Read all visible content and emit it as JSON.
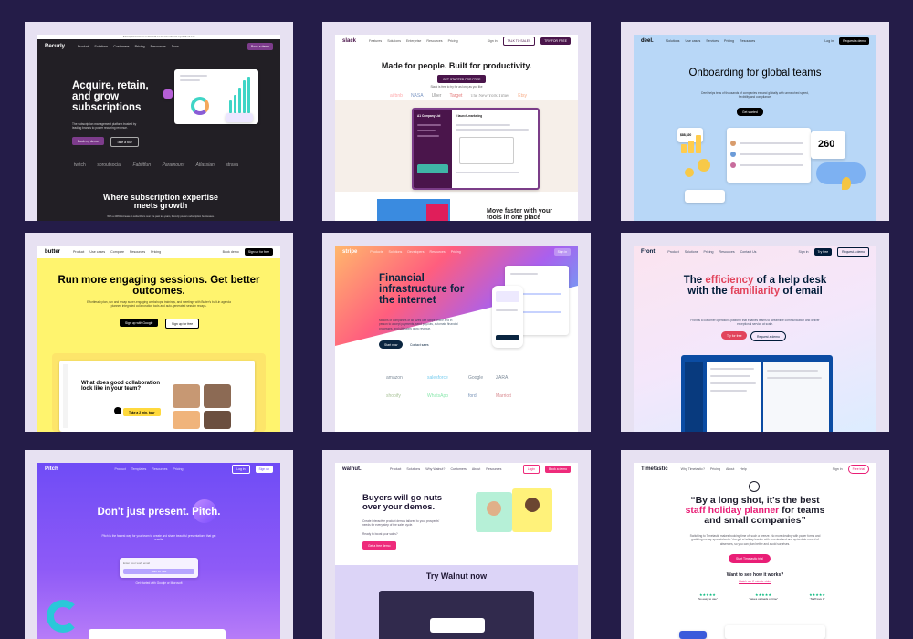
{
  "tiles": {
    "recurly": {
      "announcement": "Subscription business metrics with our latest benchmark report. Read now",
      "logo": "Recurly",
      "nav": [
        "Product",
        "Solutions",
        "Customers",
        "Pricing",
        "Resources",
        "Docs"
      ],
      "nav_btn": "Book a demo",
      "headline": "Acquire, retain, and grow subscriptions",
      "subtext": "The subscription management platform trusted by leading brands to power recurring revenue.",
      "cta_primary": "Book my demo",
      "cta_secondary": "Take a tour",
      "logos": [
        "twitch",
        "sproutsocial",
        "Fabfitfun",
        "Paramount",
        "Atlassian",
        "strava"
      ],
      "footer_headline": "Where subscription expertise meets growth",
      "footer_sub": "With a 400% increase in subscribers over the past ten years, Recurly powers subscription businesses."
    },
    "slack": {
      "logo": "slack",
      "nav": [
        "Features",
        "Solutions",
        "Enterprise",
        "Resources",
        "Pricing"
      ],
      "signin": "Sign in",
      "talk_btn": "TALK TO SALES",
      "try_btn": "TRY FOR FREE",
      "headline": "Made for people. Built for productivity.",
      "cta": "GET STARTED FOR FREE",
      "subtext": "Slack is free to try for as long as you like",
      "logos": [
        "airbnb",
        "NASA",
        "Uber",
        "Target",
        "The New York Times",
        "Etsy"
      ],
      "sidebar_title": "A1 Company Ltd",
      "channel": "# launch-marketing",
      "bottom_text": "Move faster with your tools in one place"
    },
    "deel": {
      "logo": "deel.",
      "nav": [
        "Solutions",
        "Use cases",
        "Services",
        "Pricing",
        "Resources"
      ],
      "login": "Log in",
      "demo_btn": "Request a demo",
      "headline": "Onboarding for global teams",
      "subtext": "Deel helps tens of thousands of companies expand globally with unmatched speed, flexibility and compliance.",
      "cta": "Get started",
      "stat_value": "260",
      "amount": "$88,520"
    },
    "butter": {
      "logo": "butter",
      "nav": [
        "Product",
        "Use cases",
        "Compare",
        "Resources",
        "Pricing"
      ],
      "signin": "Book demo",
      "signup": "Sign up for free",
      "headline": "Run more engaging sessions. Get better outcomes.",
      "subtext": "Effortlessly plan, run and recap super-engaging workshops, trainings, and meetings with Butter's built-in agenda planner, integrated collaboration tools and auto-generated session recaps.",
      "cta_primary": "Sign up with Google",
      "cta_secondary": "Sign up for free",
      "card_title": "What does good collaboration look like in your team?",
      "tour_label": "Take a 2 min. tour"
    },
    "stripe": {
      "logo": "stripe",
      "nav": [
        "Products",
        "Solutions",
        "Developers",
        "Resources",
        "Pricing"
      ],
      "signin": "Sign in",
      "headline": "Financial infrastructure for the internet",
      "subtext": "Millions of companies of all sizes use Stripe online and in person to accept payments, send payouts, automate financial processes, and ultimately grow revenue.",
      "cta_primary": "Start now",
      "cta_secondary": "Contact sales",
      "logos": [
        "amazon",
        "salesforce",
        "Google",
        "ZARA",
        "shopify",
        "WhatsApp",
        "ford",
        "Marriott"
      ]
    },
    "front": {
      "logo": "Front",
      "nav": [
        "Product",
        "Solutions",
        "Pricing",
        "Resources",
        "Contact Us"
      ],
      "signin": "Sign in",
      "demo_btn": "Request a demo",
      "free_btn": "Try free",
      "headline_1": "The ",
      "headline_2": "efficiency",
      "headline_3": " of a help desk with the ",
      "headline_4": "familiarity",
      "headline_5": " of email",
      "subtext": "Front is a customer operations platform that enables teams to streamline communication and deliver exceptional service at scale.",
      "cta_primary": "Try for free",
      "cta_secondary": "Request a demo"
    },
    "pitch": {
      "logo": "Pitch",
      "nav": [
        "Product",
        "Templates",
        "Resources",
        "Pricing"
      ],
      "login": "Log in",
      "signup": "Sign up",
      "headline": "Don't just present. Pitch.",
      "subtext": "Pitch is the fastest way for your team to create and share beautiful presentations that get results.",
      "email_placeholder": "Enter your work email",
      "cta": "Start for free",
      "footer": "Get started with Google or Microsoft"
    },
    "walnut": {
      "logo": "walnut.",
      "nav": [
        "Product",
        "Solutions",
        "Why Walnut?",
        "Customers",
        "About",
        "Resources"
      ],
      "login": "Login",
      "demo_btn": "Book a demo",
      "headline": "Buyers will go nuts over your demos.",
      "subtext": "Create interactive product demos tailored to your prospects' needs for every step of the sales cycle.",
      "ready": "Ready to boost your sales?",
      "cta": "Get a free demo",
      "section_title": "Try Walnut now"
    },
    "timetastic": {
      "logo": "Timetastic",
      "nav": [
        "Why Timetastic?",
        "Pricing",
        "About",
        "Help"
      ],
      "signin": "Sign in",
      "trial_btn": "Free trial",
      "headline_1": "“By a long shot, it's the best ",
      "headline_2": "staff holiday planner",
      "headline_3": " for teams and small companies”",
      "subtext": "Switching to Timetastic makes booking time off such a breeze. No more dealing with paper forms and grabbing messy spreadsheets. You get a holiday tracker with a centralised and up-to-date record of absences, so you can plan better and avoid surprises.",
      "cta": "Start Timetastic trial",
      "question": "Want to see how it works?",
      "video_link": "Watch our 2 minute video",
      "stars": "★★★★★",
      "quotes": [
        "“So easy to use”",
        "“Saves us loads of time”",
        "“Staff love it”"
      ]
    }
  }
}
